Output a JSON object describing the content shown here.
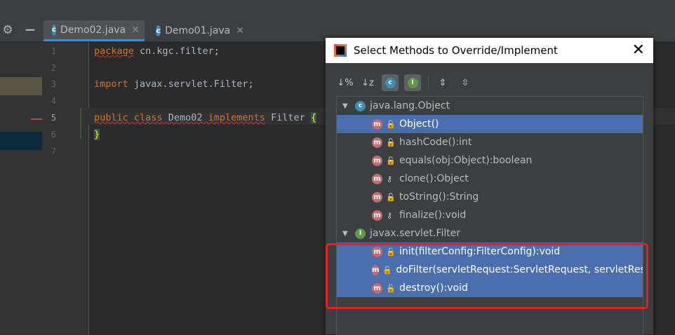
{
  "editor": {
    "tabs": [
      {
        "label": "Demo02.java",
        "icon": "class-icon",
        "active": true
      },
      {
        "label": "Demo01.java",
        "icon": "class-icon",
        "active": false
      }
    ],
    "close_glyph": "✕",
    "line_numbers": [
      "1",
      "2",
      "3",
      "4",
      "5",
      "6",
      "7"
    ],
    "code": {
      "l1_kw": "package",
      "l1_rest": " cn.kgc.filter;",
      "l3_kw": "import",
      "l3_rest": " javax.servlet.Filter;",
      "l5_kw1": "public",
      "l5_kw2": "class",
      "l5_name": "Demo02",
      "l5_kw3": "implements",
      "l5_rest": " Filter ",
      "l5_brace": "{",
      "l6_brace": "}"
    }
  },
  "dialog": {
    "title": "Select Methods to Override/Implement",
    "close_glyph": "✕",
    "toolbar": {
      "sort_visibility": "↓%",
      "sort_alpha": "↓z",
      "show_classes_letter": "c",
      "show_interfaces_letter": "I",
      "expand_all": "⇕",
      "collapse_all": "⇳"
    },
    "groups": [
      {
        "name": "java.lang.Object",
        "icon_letter": "c",
        "methods": [
          {
            "label": "Object()",
            "access": "public",
            "selected": true
          },
          {
            "label": "hashCode():int",
            "access": "public",
            "selected": false
          },
          {
            "label": "equals(obj:Object):boolean",
            "access": "public",
            "selected": false
          },
          {
            "label": "clone():Object",
            "access": "protected",
            "selected": false
          },
          {
            "label": "toString():String",
            "access": "public",
            "selected": false
          },
          {
            "label": "finalize():void",
            "access": "protected",
            "selected": false
          }
        ]
      },
      {
        "name": "javax.servlet.Filter",
        "icon_letter": "I",
        "methods": [
          {
            "label": "init(filterConfig:FilterConfig):void",
            "access": "public",
            "selected": true
          },
          {
            "label": "doFilter(servletRequest:ServletRequest, servletResponse:ServletResponse, filterChain:FilterChain):void",
            "access": "public",
            "selected": true
          },
          {
            "label": "destroy():void",
            "access": "public",
            "selected": true
          }
        ]
      }
    ],
    "method_letter": "m",
    "public_glyph": "🔓",
    "protected_glyph": "⚷"
  },
  "colors": {
    "selection": "#4b6eaf",
    "highlight_box": "#e6221c",
    "keyword": "#cc7832"
  }
}
